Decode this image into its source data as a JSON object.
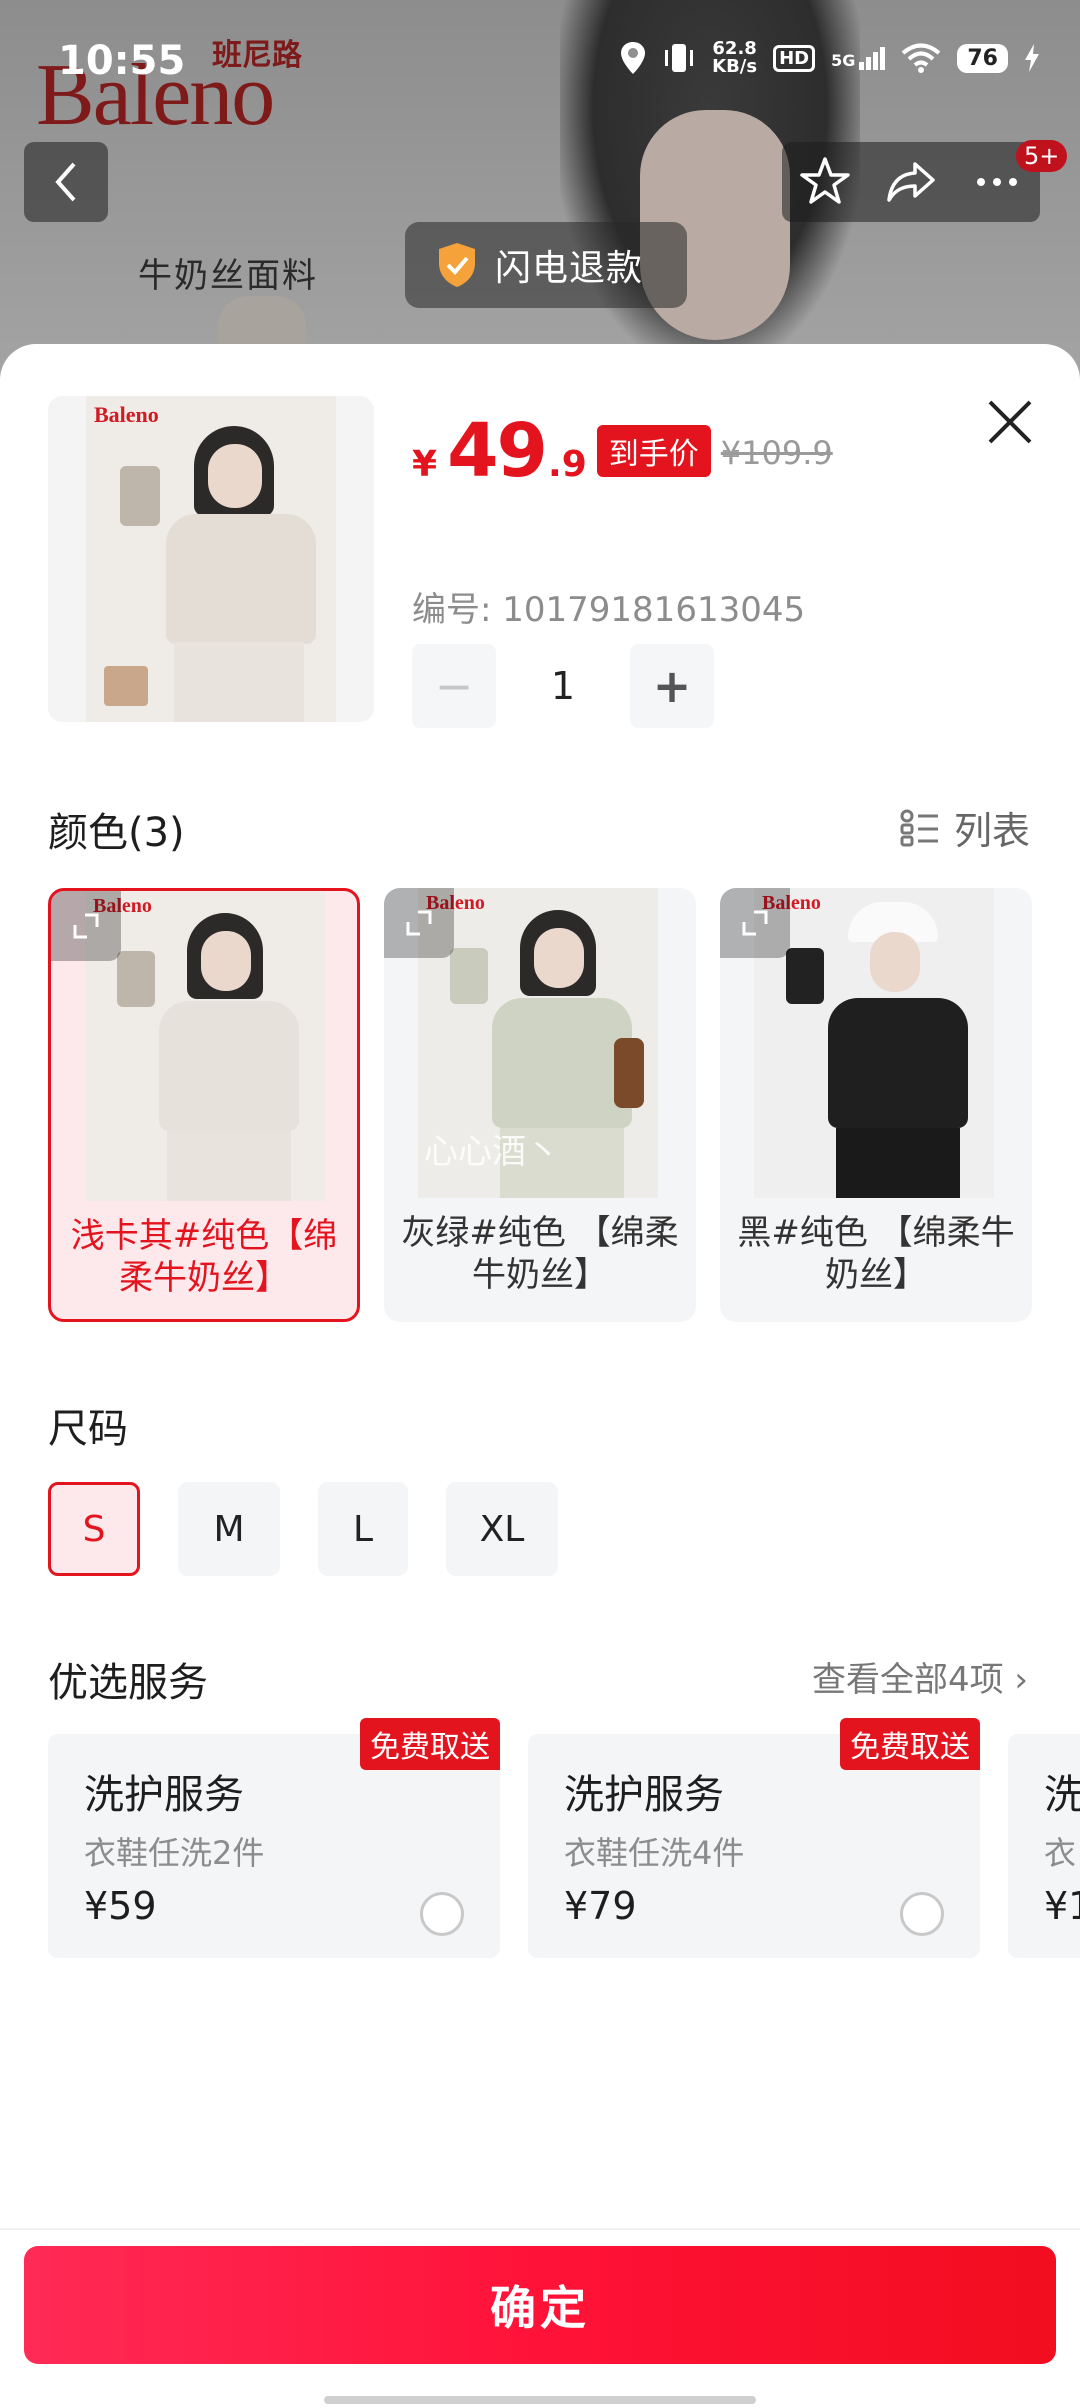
{
  "status_bar": {
    "time": "10:55",
    "net_speed_value": "62.8",
    "net_speed_unit": "KB/s",
    "hd": "HD",
    "signal": "5G",
    "battery": "76"
  },
  "background": {
    "brand_logo": "Baleno",
    "brand_cn": "班尼路",
    "fabric_label": "牛奶丝面料",
    "refund_label": "闪电退款",
    "cart_badge": "5+"
  },
  "product": {
    "thumb_logo": "Baleno",
    "currency": "¥",
    "price_int": "49",
    "price_dec": ".9",
    "price_tag": "到手价",
    "original_price": "¥109.9",
    "code_text": "编号: 10179181613045",
    "quantity": "1",
    "minus": "−",
    "plus": "+"
  },
  "color_section": {
    "title": "颜色(3)",
    "list_label": "列表",
    "options": [
      {
        "label": "浅卡其#纯色【绵柔牛奶丝】",
        "selected": true,
        "logo": "Baleno",
        "garment": "#e6e1db"
      },
      {
        "label": "灰绿#纯色 【绵柔牛奶丝】",
        "selected": false,
        "logo": "Baleno",
        "garment": "#cfd3c4",
        "watermark": "心心酒丶"
      },
      {
        "label": "黑#纯色 【绵柔牛奶丝】",
        "selected": false,
        "logo": "Baleno",
        "garment": "#1f1f1f"
      }
    ]
  },
  "size_section": {
    "title": "尺码",
    "options": [
      {
        "label": "S",
        "selected": true
      },
      {
        "label": "M",
        "selected": false
      },
      {
        "label": "L",
        "selected": false
      },
      {
        "label": "XL",
        "selected": false
      }
    ]
  },
  "service_section": {
    "title": "优选服务",
    "view_all": "查看全部4项 ›",
    "items": [
      {
        "badge": "免费取送",
        "title": "洗护服务",
        "desc": "衣鞋任洗2件",
        "price": "¥59"
      },
      {
        "badge": "免费取送",
        "title": "洗护服务",
        "desc": "衣鞋任洗4件",
        "price": "¥79"
      },
      {
        "title": "洗",
        "desc": "衣",
        "price": "¥1"
      }
    ]
  },
  "confirm_button": "确定",
  "colors": {
    "accent": "#e4141e",
    "selected_bg": "#fde8ec",
    "card_bg": "#f4f5f7"
  }
}
